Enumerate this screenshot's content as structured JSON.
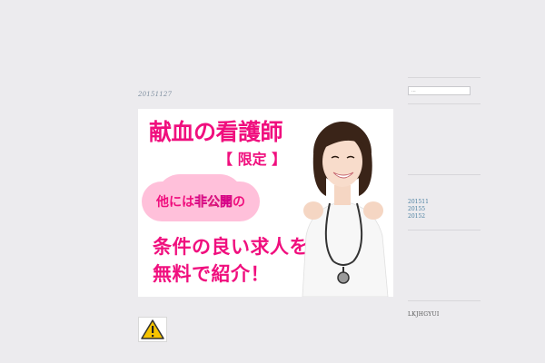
{
  "post": {
    "date": "20151127",
    "banner": {
      "title": "献血の看護師",
      "limited": "【 限定 】",
      "private_pre": "他には",
      "private_highlight": "非公開",
      "private_post": "の",
      "line1": "条件の良い求人を",
      "line2": "無料で紹介！"
    }
  },
  "sidebar": {
    "search_placeholder": "...",
    "archives": [
      "201511",
      "20155",
      "20152"
    ],
    "widget_title": "LKJHGYUI"
  },
  "colors": {
    "background": "#ecebee",
    "banner_pink": "#f00f7e",
    "link": "#4a7fa0"
  }
}
